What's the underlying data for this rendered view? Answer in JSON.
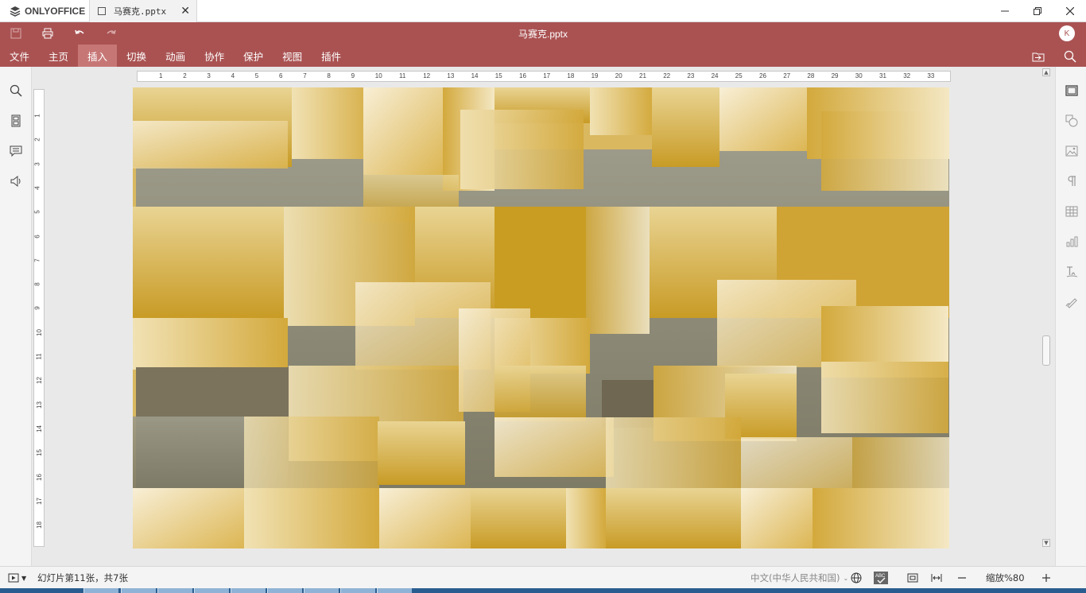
{
  "app": {
    "brand": "ONLYOFFICE",
    "tab_label": "马赛克.pptx",
    "tab_close": "✕",
    "window_controls": [
      "minimize-icon",
      "restore-icon",
      "close-icon"
    ]
  },
  "header": {
    "doc_title": "马赛克.pptx",
    "avatar_initial": "K",
    "quick_access": [
      "save-icon",
      "print-icon",
      "undo-icon",
      "redo-icon"
    ],
    "menu": [
      "文件",
      "主页",
      "插入",
      "切换",
      "动画",
      "协作",
      "保护",
      "视图",
      "插件"
    ],
    "active_menu": "插入",
    "colors": {
      "header_bg": "#aa5252",
      "active_tab": "#c77676"
    }
  },
  "left_toolbar": [
    "search-icon",
    "slides-thumbnails-icon",
    "comments-icon",
    "feedback-icon"
  ],
  "right_toolbar": [
    "slide-settings-icon",
    "shape-settings-icon",
    "image-settings-icon",
    "paragraph-settings-icon",
    "table-settings-icon",
    "chart-settings-icon",
    "text-art-settings-icon",
    "signature-settings-icon"
  ],
  "rulers": {
    "horizontal": [
      "1",
      "2",
      "3",
      "4",
      "5",
      "6",
      "7",
      "8",
      "9",
      "10",
      "11",
      "12",
      "13",
      "14",
      "15",
      "16",
      "17",
      "18",
      "19",
      "20",
      "21",
      "22",
      "23",
      "24",
      "25",
      "26",
      "27",
      "28",
      "29",
      "30",
      "31",
      "32",
      "33"
    ],
    "vertical": [
      "1",
      "2",
      "3",
      "4",
      "5",
      "6",
      "7",
      "8",
      "9",
      "10",
      "11",
      "12",
      "13",
      "14",
      "15",
      "16",
      "17",
      "18"
    ]
  },
  "status": {
    "slide_info": "幻灯片第11张，共7张",
    "language": "中文(中华人民共和国)",
    "zoom_label": "缩放%80"
  }
}
